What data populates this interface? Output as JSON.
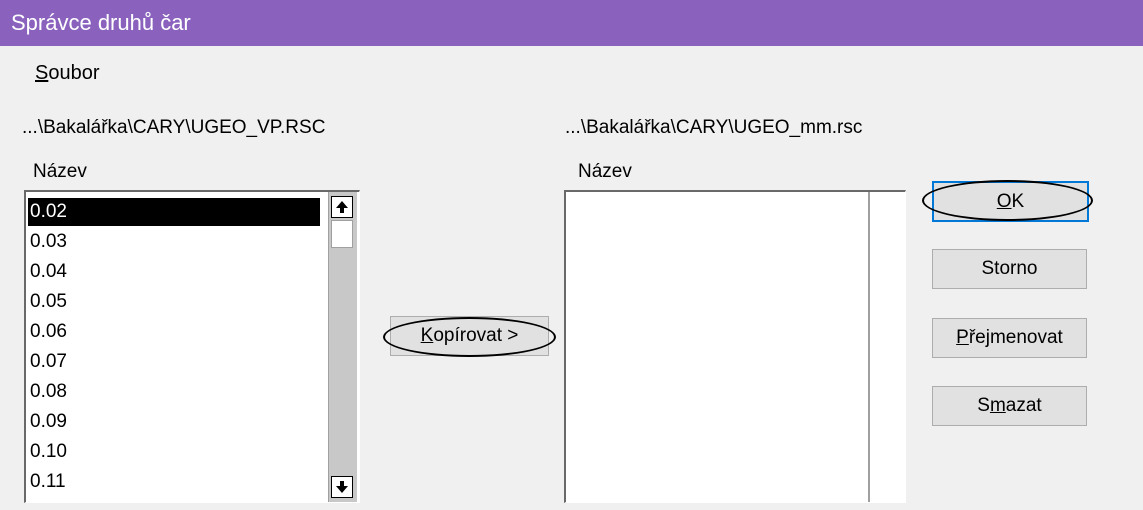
{
  "window": {
    "title": "Správce druhů čar"
  },
  "menu": {
    "items": [
      {
        "accel": "S",
        "rest": "oubor"
      }
    ]
  },
  "left_panel": {
    "path": "...\\Bakalářka\\CARY\\UGEO_VP.RSC",
    "column_header": "Název",
    "items": [
      "0.02",
      "0.03",
      "0.04",
      "0.05",
      "0.06",
      "0.07",
      "0.08",
      "0.09",
      "0.10",
      "0.11"
    ],
    "selected_index": 0
  },
  "right_panel": {
    "path": "...\\Bakalářka\\CARY\\UGEO_mm.rsc",
    "column_header": "Název",
    "items": []
  },
  "copy_button": {
    "accel": "K",
    "rest": "opírovat >"
  },
  "buttons": {
    "ok": {
      "accel": "O",
      "rest": "K"
    },
    "storno": {
      "label": "Storno"
    },
    "rename": {
      "accel": "P",
      "rest": "řejmenovat"
    },
    "delete": {
      "before": "S",
      "accel": "m",
      "rest": "azat"
    }
  },
  "icons": {
    "scroll_up": "arrow-up-icon",
    "scroll_down": "arrow-down-icon"
  }
}
